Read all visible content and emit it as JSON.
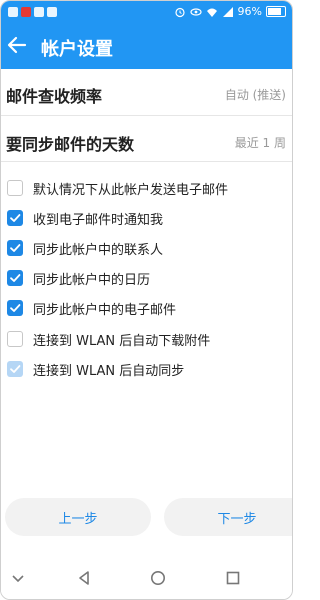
{
  "status_bar": {
    "battery": "96%",
    "battery_level": 0.96,
    "icons": [
      "app-icon",
      "app-icon-red",
      "app-icon",
      "app-icon"
    ],
    "right_icons": [
      "alarm-icon",
      "eye-icon",
      "wifi-icon",
      "signal-icon",
      "battery-icon"
    ]
  },
  "app_bar": {
    "title": "帐户设置"
  },
  "settings": {
    "check_frequency": {
      "label": "邮件查收频率",
      "value": "自动 (推送)"
    },
    "sync_days": {
      "label": "要同步邮件的天数",
      "value": "最近 1 周"
    }
  },
  "options": [
    {
      "label": "默认情况下从此帐户发送电子邮件",
      "state": "off"
    },
    {
      "label": "收到电子邮件时通知我",
      "state": "on"
    },
    {
      "label": "同步此帐户中的联系人",
      "state": "on"
    },
    {
      "label": "同步此帐户中的日历",
      "state": "on"
    },
    {
      "label": "同步此帐户中的电子邮件",
      "state": "on"
    },
    {
      "label": "连接到 WLAN 后自动下载附件",
      "state": "off"
    },
    {
      "label": "连接到 WLAN 后自动同步",
      "state": "disabled-on"
    }
  ],
  "buttons": {
    "prev": "上一步",
    "next": "下一步"
  },
  "colors": {
    "primary": "#2196f3",
    "checkbox_on": "#1e88e5",
    "checkbox_disabled": "#b5d6f5"
  }
}
